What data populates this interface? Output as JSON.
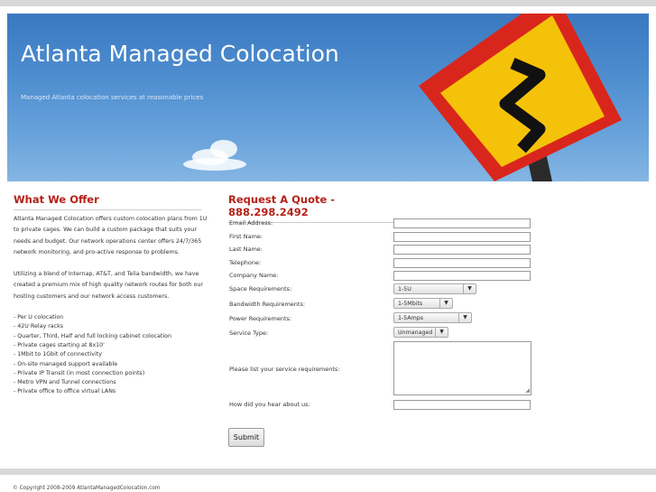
{
  "header": {
    "title": "Atlanta Managed Colocation",
    "tagline": "Managed Atlanta colocation services at reasonable prices"
  },
  "offer": {
    "heading": "What We Offer",
    "paragraphs": [
      "Atlanta Managed Colocation offers custom colocation plans from 1U to private cages. We can build a custom package that suits your needs and budget. Our network operations center offers 24/7/365 network monitoring, and pro-active response to problems.",
      "Utilizing a blend of Internap, AT&T, and Telia bandwidth, we have created a premium mix of high quality network routes for both our hosting customers and our network access customers."
    ],
    "features": [
      "- Per U colocation",
      "- 42U Relay racks",
      "- Quarter, Third, Half and full locking cabinet colocation",
      "- Private cages starting at 8x10'",
      "- 1Mbit to 1Gbit of connectivity",
      "- On-site managed support available",
      "- Private IP Transit (in most connection points)",
      "- Metro VPN and Tunnel connections",
      "- Private office to office virtual LANs"
    ]
  },
  "quote": {
    "heading": "Request A Quote - 888.298.2492",
    "labels": {
      "email": "Email Address:",
      "first": "First Name:",
      "last": "Last Name:",
      "phone": "Telephone:",
      "company": "Company Name:",
      "space": "Space Requirements:",
      "bandwidth": "Bandwidth Requirements:",
      "power": "Power Requirements:",
      "service": "Service Type:",
      "requirements": "Please list your service requirements:",
      "hear": "How did you hear about us:"
    },
    "selects": {
      "space": "1-5U",
      "bandwidth": "1-5Mbits",
      "power": "1-5Amps",
      "service": "Unmanaged"
    },
    "submit": "Submit"
  },
  "footer": {
    "copyright": "© Copyright 2008-2009 AtlantaManagedColocation.com"
  }
}
